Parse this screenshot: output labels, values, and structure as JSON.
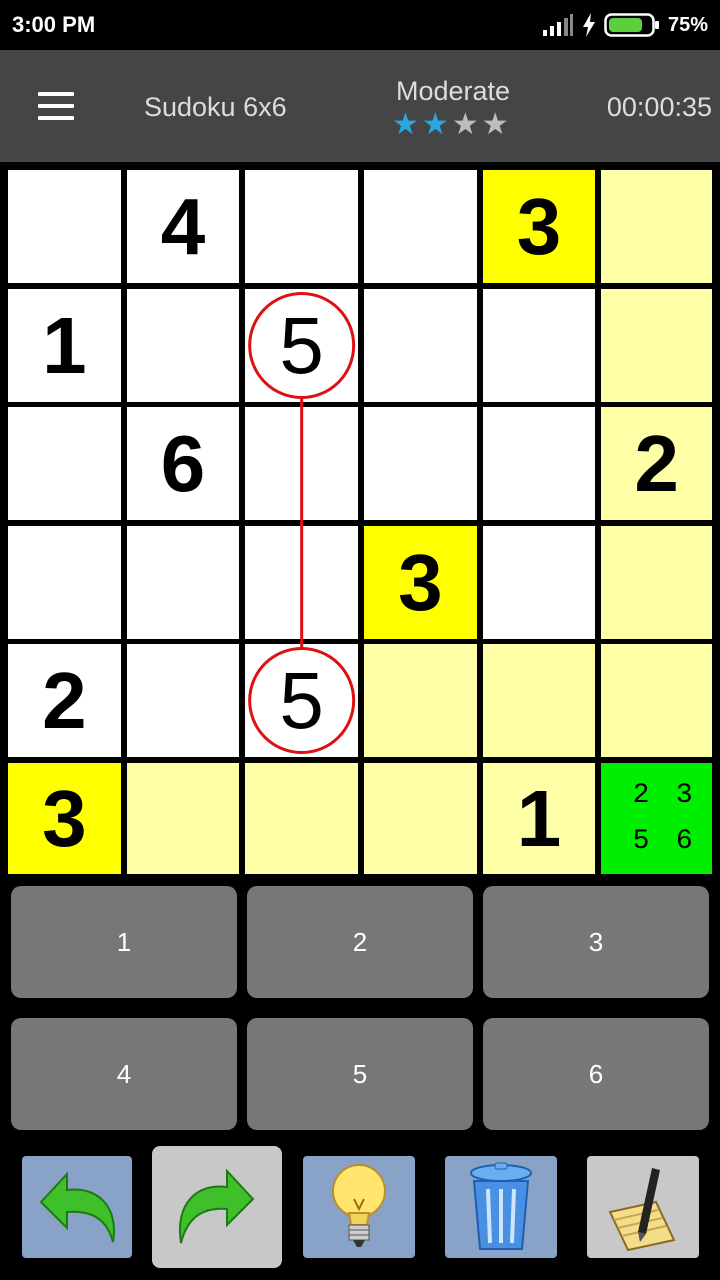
{
  "status_bar": {
    "time": "3:00 PM",
    "battery_percent": "75%",
    "icons": [
      "signal-icon",
      "charging-icon",
      "battery-icon"
    ]
  },
  "header": {
    "title": "Sudoku 6x6",
    "difficulty": "Moderate",
    "difficulty_stars_filled": 2,
    "difficulty_stars_total": 4,
    "timer": "00:00:35"
  },
  "board": {
    "size": 6,
    "rows": [
      [
        "",
        "4",
        "",
        "",
        "3",
        ""
      ],
      [
        "1",
        "",
        "5",
        "",
        "",
        ""
      ],
      [
        "",
        "6",
        "",
        "",
        "",
        "2"
      ],
      [
        "",
        "",
        "",
        "3",
        "",
        ""
      ],
      [
        "2",
        "",
        "5",
        "",
        "",
        ""
      ],
      [
        "3",
        "",
        "",
        "",
        "1",
        ""
      ]
    ],
    "highlight": [
      [
        "w",
        "w",
        "w",
        "w",
        "y",
        "p"
      ],
      [
        "w",
        "w",
        "w",
        "w",
        "w",
        "p"
      ],
      [
        "w",
        "w",
        "w",
        "w",
        "w",
        "p"
      ],
      [
        "w",
        "w",
        "w",
        "y",
        "w",
        "p"
      ],
      [
        "w",
        "w",
        "w",
        "p",
        "p",
        "p"
      ],
      [
        "y",
        "p",
        "p",
        "p",
        "p",
        "g"
      ]
    ],
    "bold_digits": true,
    "conflict_cells": [
      [
        1,
        2
      ],
      [
        4,
        2
      ]
    ],
    "selected_cell": [
      5,
      5
    ],
    "selected_notes": [
      "2",
      "3",
      "5",
      "6"
    ],
    "colors": {
      "w": "#ffffff",
      "y": "#ffff00",
      "p": "#ffffa8",
      "g": "#00ee00",
      "conflict": "#dd1111"
    }
  },
  "keypad": {
    "keys": [
      "1",
      "2",
      "3",
      "4",
      "5",
      "6"
    ]
  },
  "toolbar": {
    "tools": [
      {
        "name": "undo-icon",
        "state": "active"
      },
      {
        "name": "redo-icon",
        "state": "disabled"
      },
      {
        "name": "hint-bulb-icon",
        "state": "active"
      },
      {
        "name": "trash-icon",
        "state": "active"
      },
      {
        "name": "notes-pencil-icon",
        "state": "active"
      }
    ]
  }
}
